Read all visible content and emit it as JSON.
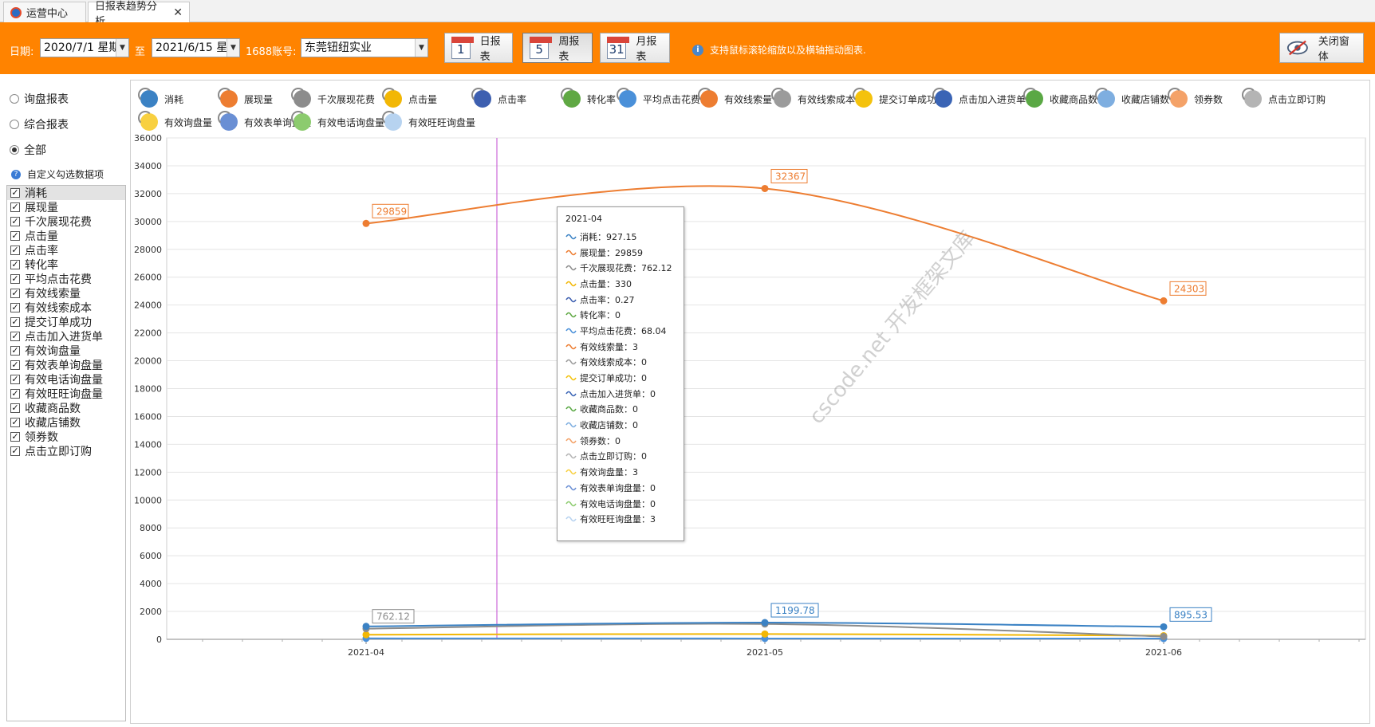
{
  "tabs": [
    {
      "label": "运营中心"
    },
    {
      "label": "日报表趋势分析",
      "close": "✕"
    }
  ],
  "toolbar": {
    "date_label": "日期:",
    "date_from": "2020/7/1 星期",
    "to_label": "至",
    "date_to": "2021/6/15 星",
    "account_label": "1688账号:",
    "account_value": "东莞钮纽实业",
    "btn_day": {
      "num": "1",
      "label": "日报表"
    },
    "btn_week": {
      "num": "5",
      "label": "周报表"
    },
    "btn_month": {
      "num": "31",
      "label": "月报表"
    },
    "hint": "支持鼠标滚轮缩放以及横轴拖动图表.",
    "close_label": "关闭窗体"
  },
  "left": {
    "radios": [
      {
        "label": "询盘报表",
        "on": false
      },
      {
        "label": "综合报表",
        "on": false
      },
      {
        "label": "全部",
        "on": true
      }
    ],
    "custom_label": "自定义勾选数据项",
    "checks": [
      "消耗",
      "展现量",
      "千次展现花费",
      "点击量",
      "点击率",
      "转化率",
      "平均点击花费",
      "有效线索量",
      "有效线索成本",
      "提交订单成功",
      "点击加入进货单",
      "有效询盘量",
      "有效表单询盘量",
      "有效电话询盘量",
      "有效旺旺询盘量",
      "收藏商品数",
      "收藏店铺数",
      "领券数",
      "点击立即订购"
    ]
  },
  "legend": [
    {
      "label": "消耗",
      "color": "#3b82c4"
    },
    {
      "label": "展现量",
      "color": "#ed7d31"
    },
    {
      "label": "千次展现花费",
      "color": "#8c8c8c"
    },
    {
      "label": "点击量",
      "color": "#f2b705"
    },
    {
      "label": "点击率",
      "color": "#3d5fb0"
    },
    {
      "label": "转化率",
      "color": "#5fa843"
    },
    {
      "label": "平均点击花费",
      "color": "#4a90d9"
    },
    {
      "label": "有效线索量",
      "color": "#ed7d31"
    },
    {
      "label": "有效线索成本",
      "color": "#9b9b9b"
    },
    {
      "label": "提交订单成功",
      "color": "#f4c20d"
    },
    {
      "label": "点击加入进货单",
      "color": "#3a64b5"
    },
    {
      "label": "收藏商品数",
      "color": "#5aa844"
    },
    {
      "label": "收藏店铺数",
      "color": "#7eaee0"
    },
    {
      "label": "领券数",
      "color": "#f4a268"
    },
    {
      "label": "点击立即订购",
      "color": "#b4b4b4"
    },
    {
      "label": "有效询盘量",
      "color": "#f8d040"
    },
    {
      "label": "有效表单询盘量",
      "color": "#6a8fd4"
    },
    {
      "label": "有效电话询盘量",
      "color": "#8ccb6e"
    },
    {
      "label": "有效旺旺询盘量",
      "color": "#b7d3f0"
    }
  ],
  "tooltip": {
    "title": "2021-04",
    "rows": [
      "消耗：927.15",
      "展现量：29859",
      "千次展现花费：762.12",
      "点击量：330",
      "点击率：0.27",
      "转化率：0",
      "平均点击花费：68.04",
      "有效线索量：3",
      "有效线索成本：0",
      "提交订单成功：0",
      "点击加入进货单：0",
      "收藏商品数：0",
      "收藏店铺数：0",
      "领券数：0",
      "点击立即订购：0",
      "有效询盘量：3",
      "有效表单询盘量：0",
      "有效电话询盘量：0",
      "有效旺旺询盘量：3"
    ]
  },
  "watermark": "cscode.net 开发框架文库",
  "chart_data": {
    "type": "line",
    "x": [
      "2021-04",
      "2021-05",
      "2021-06"
    ],
    "ylim": [
      0,
      36000
    ],
    "yticks": [
      0,
      2000,
      4000,
      6000,
      8000,
      10000,
      12000,
      14000,
      16000,
      18000,
      20000,
      22000,
      24000,
      26000,
      28000,
      30000,
      32000,
      34000,
      36000
    ],
    "grid": true,
    "series": [
      {
        "name": "展现量",
        "color": "#ed7d31",
        "values": [
          29859,
          32367,
          24303
        ],
        "labels": [
          "29859",
          "32367",
          "24303"
        ]
      },
      {
        "name": "消耗",
        "color": "#3b82c4",
        "values": [
          927.15,
          1199.78,
          895.53
        ],
        "labels": [
          "",
          "1199.78",
          "895.53"
        ]
      },
      {
        "name": "千次展现花费",
        "color": "#8c8c8c",
        "values": [
          762.12,
          1100,
          200
        ],
        "labels": [
          "762.12",
          "",
          ""
        ]
      },
      {
        "name": "点击量",
        "color": "#f2b705",
        "values": [
          330,
          380,
          260
        ],
        "labels": [
          "",
          "",
          ""
        ]
      },
      {
        "name": "平均点击花费",
        "color": "#4a90d9",
        "values": [
          68.04,
          60,
          55
        ],
        "labels": [
          "",
          "",
          ""
        ]
      }
    ]
  }
}
